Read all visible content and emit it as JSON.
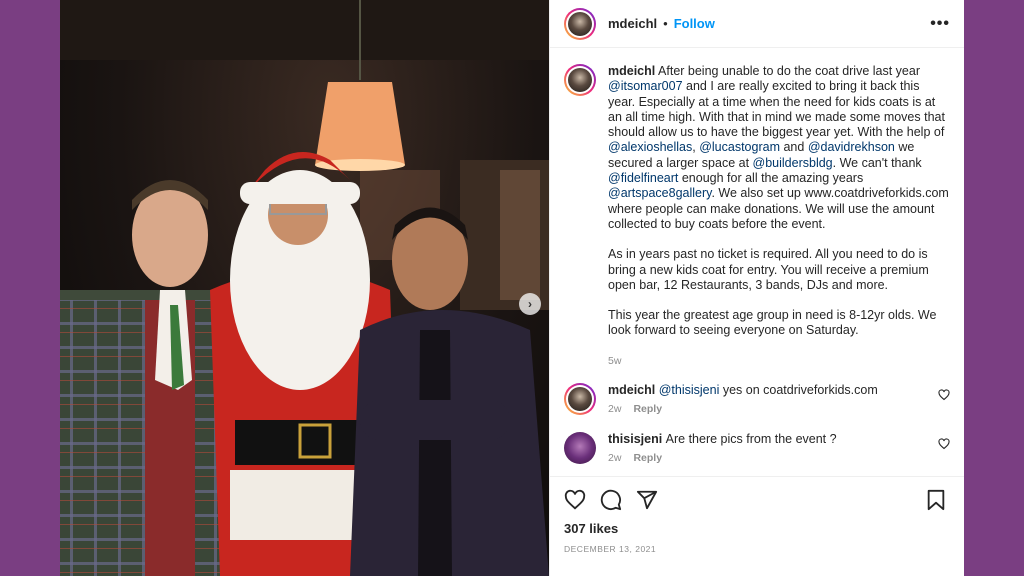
{
  "post": {
    "username": "mdeichl",
    "follow_label": "Follow",
    "more_label": "•••",
    "caption": {
      "user": "mdeichl",
      "paragraphs": [
        [
          {
            "t": " After being unable to do the coat drive last year "
          },
          {
            "m": "@itsomar007"
          },
          {
            "t": " and I are really excited to bring it back this year. Especially at a time when the need for kids coats is at an all time high. With that in mind we made some moves that should allow us to have the biggest year yet. With the help of "
          },
          {
            "m": "@alexioshellas"
          },
          {
            "t": ", "
          },
          {
            "m": "@lucastogram"
          },
          {
            "t": " and "
          },
          {
            "m": "@davidrekhson"
          },
          {
            "t": " we secured a larger space at "
          },
          {
            "m": "@buildersbldg"
          },
          {
            "t": ". We can't thank "
          },
          {
            "m": "@fidelfineart"
          },
          {
            "t": " enough for all the amazing years "
          },
          {
            "m": "@artspace8gallery"
          },
          {
            "t": ". We also set up www.coatdriveforkids.com where people can make donations. We will use the amount collected to buy coats before the event."
          }
        ],
        [
          {
            "t": "As in years past no ticket is required. All you need to do is bring a new kids coat for entry. You will receive a premium open bar, 12 Restaurants, 3 bands, DJs and more."
          }
        ],
        [
          {
            "t": "This year the greatest age group in need is 8-12yr olds. We look forward to seeing everyone on Saturday."
          }
        ]
      ],
      "age": "5w"
    },
    "comments": [
      {
        "user": "mdeichl",
        "mention": "@thisisjeni",
        "text": " yes on coatdriveforkids.com",
        "age": "2w",
        "reply": "Reply"
      },
      {
        "user": "thisisjeni",
        "mention": "",
        "text": " Are there pics from the event ?",
        "age": "2w",
        "reply": "Reply"
      }
    ],
    "likes": "307 likes",
    "date": "DECEMBER 13, 2021",
    "next_arrow": "›"
  },
  "colors": {
    "background": "#7a3e82",
    "link": "#0095f6",
    "mention": "#00376b"
  }
}
